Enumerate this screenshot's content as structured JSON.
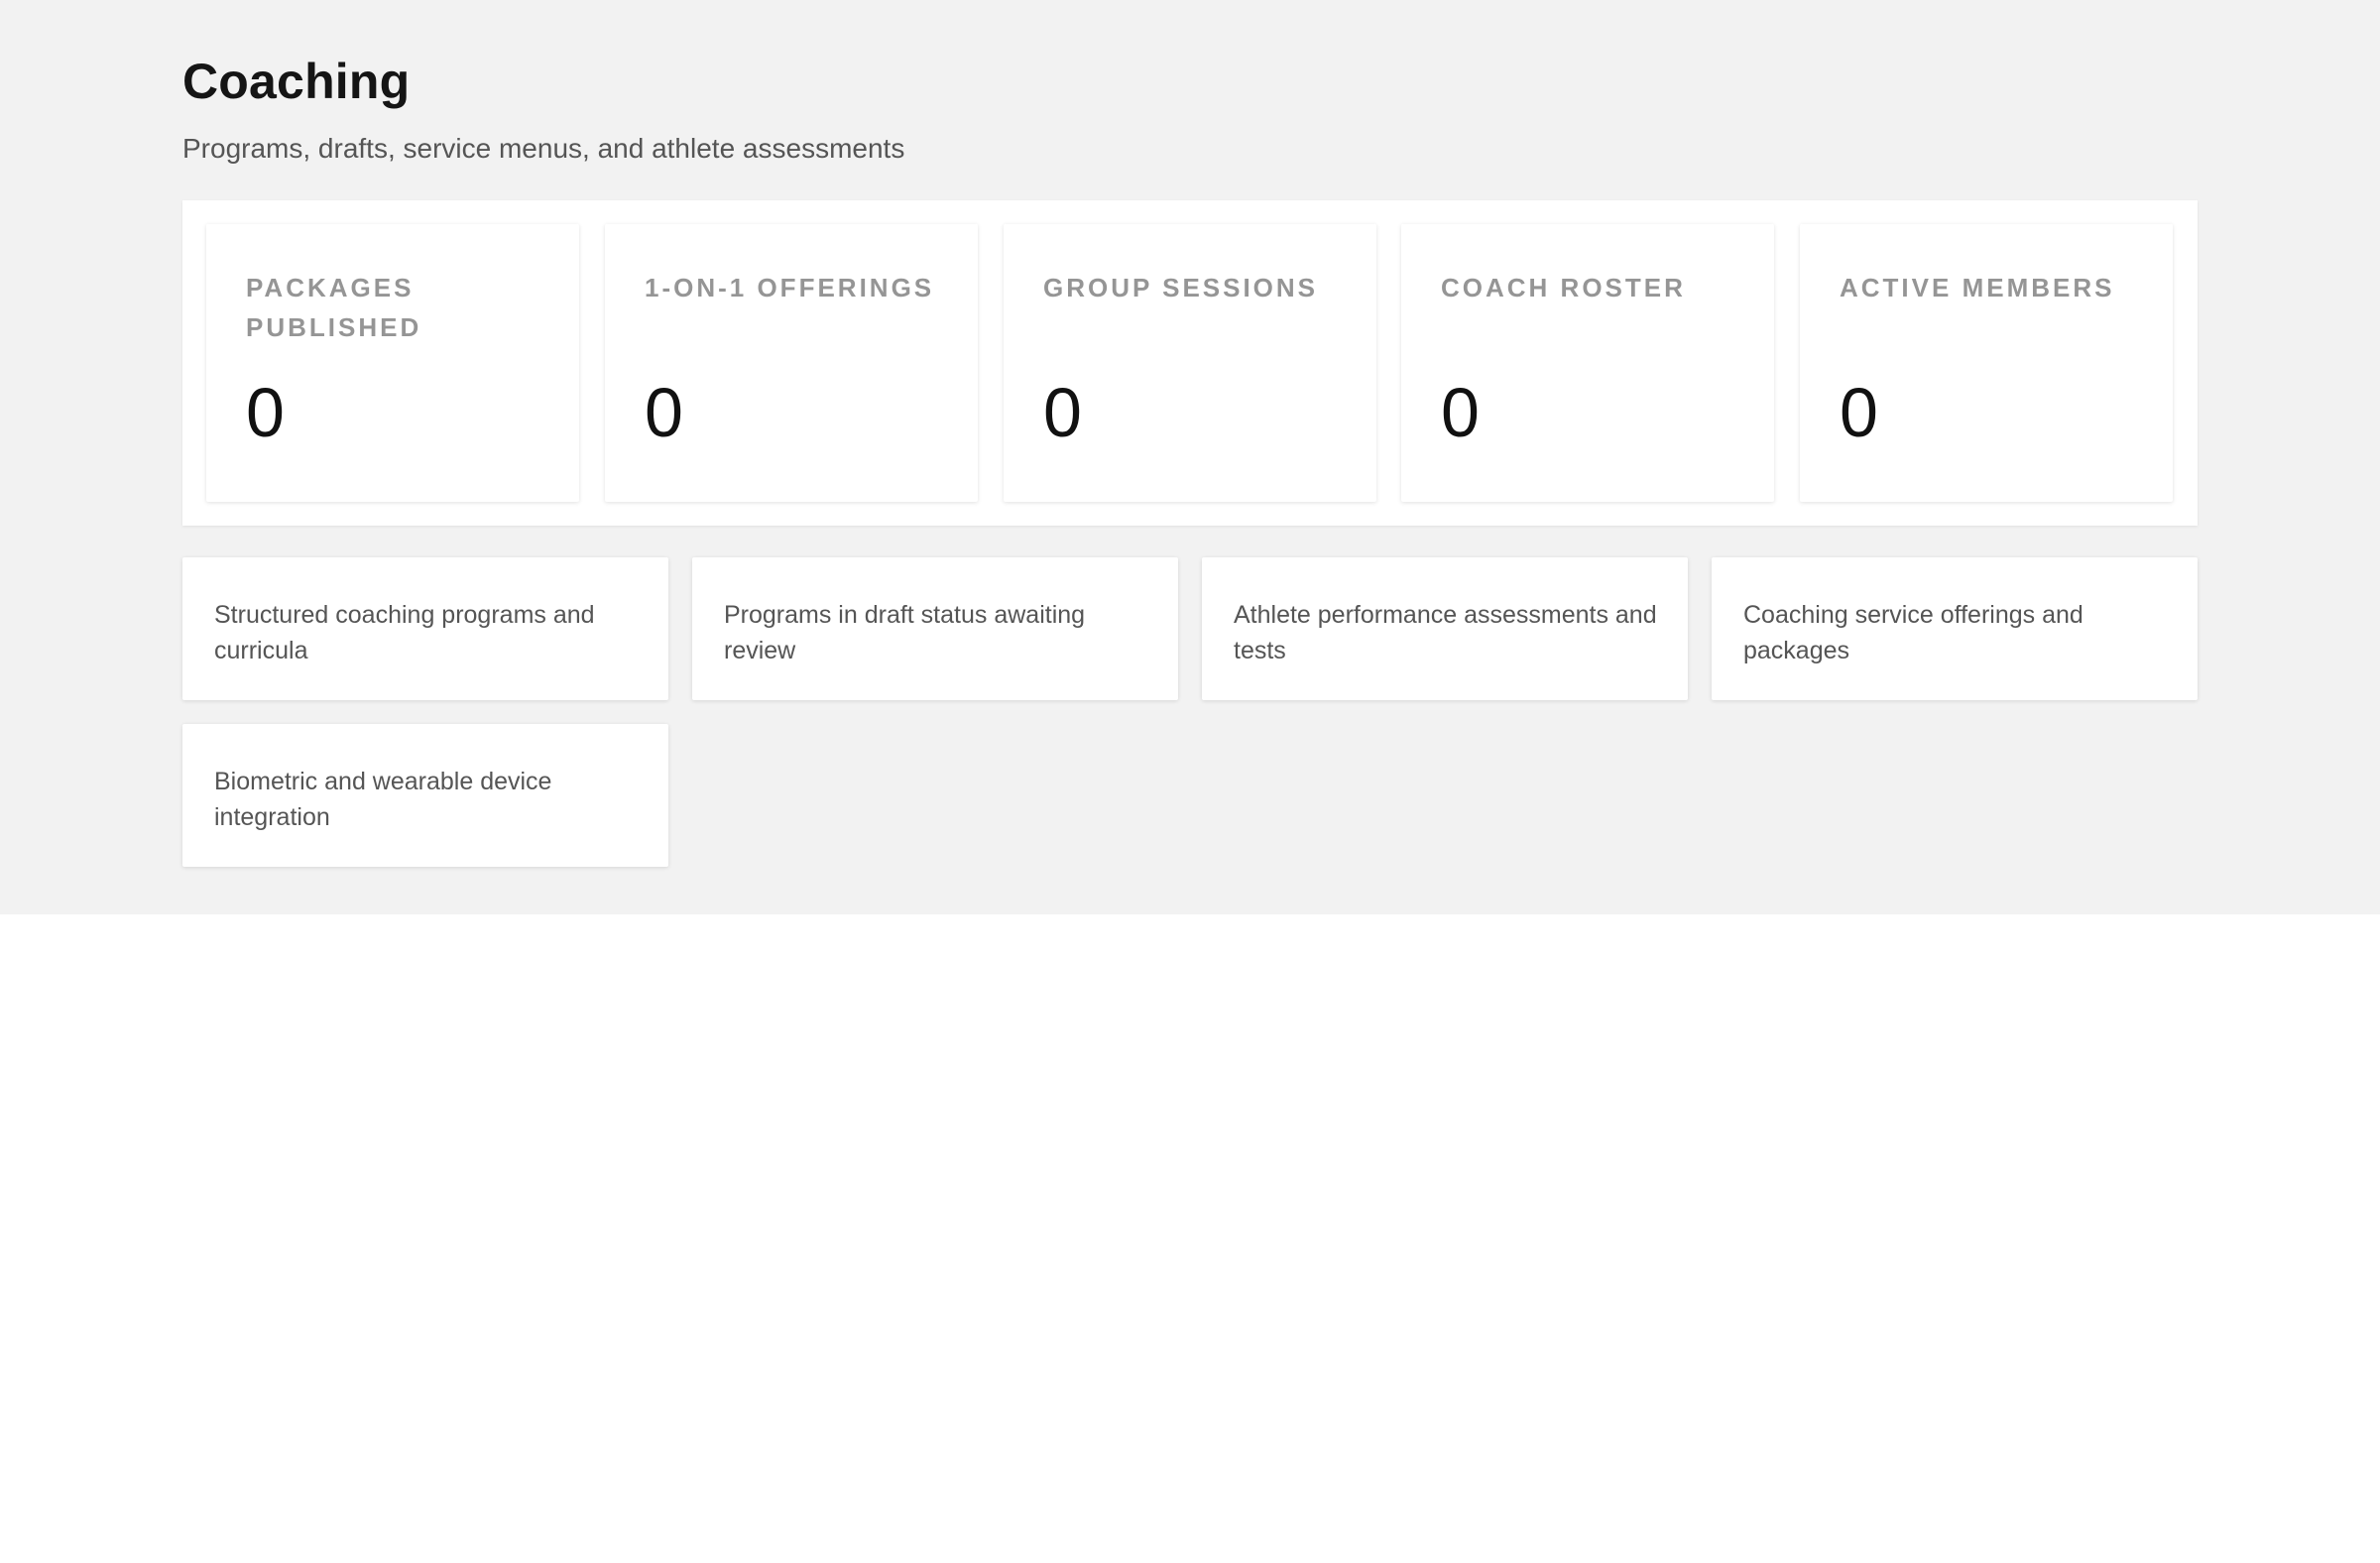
{
  "header": {
    "title": "Coaching",
    "subtitle": "Programs, drafts, service menus, and athlete assessments"
  },
  "stats": [
    {
      "label": "PACKAGES PUBLISHED",
      "value": "0"
    },
    {
      "label": "1-ON-1 OFFERINGS",
      "value": "0"
    },
    {
      "label": "GROUP SESSIONS",
      "value": "0"
    },
    {
      "label": "COACH ROSTER",
      "value": "0"
    },
    {
      "label": "ACTIVE MEMBERS",
      "value": "0"
    }
  ],
  "sections": [
    {
      "description": "Structured coaching programs and curricula"
    },
    {
      "description": "Programs in draft status awaiting review"
    },
    {
      "description": "Athlete performance assessments and tests"
    },
    {
      "description": "Coaching service offerings and packages"
    },
    {
      "description": "Biometric and wearable device integration"
    }
  ],
  "colors": {
    "background": "#f2f2f2",
    "card": "#ffffff",
    "title": "#151515",
    "muted_label": "#959595",
    "body_text": "#555555"
  }
}
